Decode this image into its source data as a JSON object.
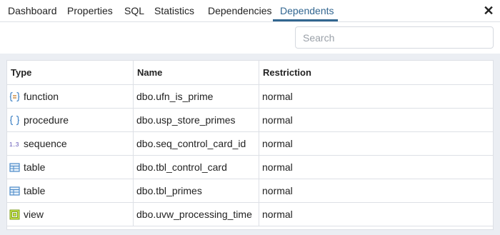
{
  "tabs": [
    {
      "label": "Dashboard"
    },
    {
      "label": "Properties"
    },
    {
      "label": "SQL"
    },
    {
      "label": "Statistics"
    },
    {
      "label": "Dependencies"
    },
    {
      "label": "Dependents",
      "active": true
    }
  ],
  "close_glyph": "✕",
  "search": {
    "placeholder": "Search",
    "value": ""
  },
  "grid": {
    "columns": [
      "Type",
      "Name",
      "Restriction"
    ],
    "rows": [
      {
        "type": "function",
        "icon": "function-icon",
        "name": "dbo.ufn_is_prime",
        "restriction": "normal"
      },
      {
        "type": "procedure",
        "icon": "procedure-icon",
        "name": "dbo.usp_store_primes",
        "restriction": "normal"
      },
      {
        "type": "sequence",
        "icon": "sequence-icon",
        "name": "dbo.seq_control_card_id",
        "restriction": "normal"
      },
      {
        "type": "table",
        "icon": "table-icon",
        "name": "dbo.tbl_control_card",
        "restriction": "normal"
      },
      {
        "type": "table",
        "icon": "table-icon",
        "name": "dbo.tbl_primes",
        "restriction": "normal"
      },
      {
        "type": "view",
        "icon": "view-icon",
        "name": "dbo.uvw_processing_time",
        "restriction": "normal"
      }
    ]
  },
  "colors": {
    "accent": "#326690",
    "grid_border": "#dde0e6",
    "background": "#ebeef3"
  }
}
